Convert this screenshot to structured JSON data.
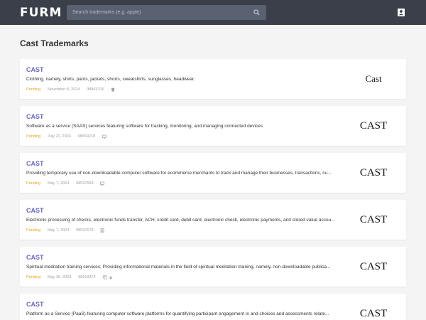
{
  "header": {
    "logo": "FURM",
    "search_placeholder": "Search trademarks (e.g. apple)"
  },
  "page_title": "Cast Trademarks",
  "colors": {
    "topbar": "#3a3f4a",
    "title_accent": "#6b6cc1",
    "pending": "#e6a21f"
  },
  "trademarks": [
    {
      "name": "CAST",
      "description": "Clothing, namely, shirts, pants, jackets, shorts, sweatshirts, sunglasses, headwear.",
      "status": "Pending",
      "date": "November 8, 2024",
      "serial": "98843316",
      "icons": [
        "shirt-icon"
      ],
      "logo_text": "Cast"
    },
    {
      "name": "CAST",
      "description": "Software as a service (SAAS) services featuring software for tracking, monitoring, and managing connected devices",
      "status": "Pending",
      "date": "July 21, 2024",
      "serial": "98659218",
      "icons": [
        "monitor-icon"
      ],
      "logo_text": "CAST"
    },
    {
      "name": "CAST",
      "description": "Providing temporary use of non-downloadable computer software for ecommerce merchants to track and manage their businesses, transactions, cu...",
      "status": "Pending",
      "date": "May 7, 2024",
      "serial": "98537693",
      "icons": [
        "monitor-icon"
      ],
      "logo_text": "CAST"
    },
    {
      "name": "CAST",
      "description": "Electronic processing of checks, electronic funds transfer, ACH, credit card, debit card, electronic check, electronic payments, and stored value accou...",
      "status": "Pending",
      "date": "May 7, 2024",
      "serial": "98537678",
      "icons": [
        "building-icon"
      ],
      "logo_text": "CAST"
    },
    {
      "name": "CAST",
      "description": "Spiritual meditation training services; Providing informational materials in the field of spiritual meditation training, namely, non-downloadable publica...",
      "status": "Pending",
      "date": "May 30, 2023",
      "serial": "98019374",
      "icons": [
        "copy-icon",
        "spa-icon"
      ],
      "logo_text": "CAST"
    },
    {
      "name": "CAST",
      "description": "Platform as a Service (PaaS) featuring computer software platforms for quantifying participant engagement in and choices and assessments relate...",
      "status": "",
      "date": "",
      "serial": "",
      "icons": [],
      "logo_text": "CAST"
    }
  ]
}
